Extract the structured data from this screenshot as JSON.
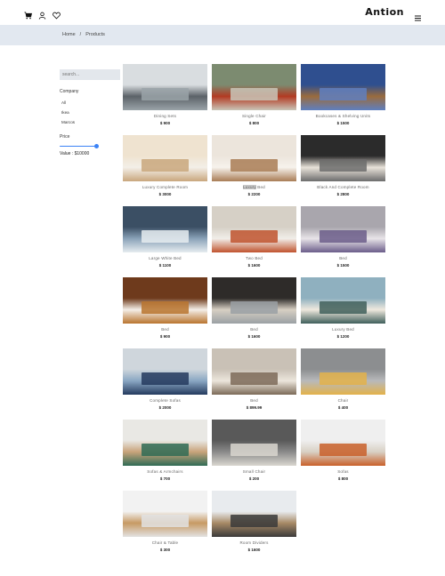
{
  "header": {
    "brand": "Antion",
    "icons": [
      "cart-icon",
      "user-icon",
      "heart-icon",
      "menu-icon"
    ]
  },
  "breadcrumb": {
    "home": "Home",
    "separator": "/",
    "current": "Products"
  },
  "sidebar": {
    "search_placeholder": "search...",
    "company_label": "Company",
    "companies": [
      "All",
      "Ikea",
      "Marcos"
    ],
    "price_label": "Price",
    "price_value_label": "Value : $10000",
    "price_fraction": 1.0
  },
  "products": [
    {
      "name": "Dining Sets",
      "price": "$ 900",
      "palette": [
        "#d9dde0",
        "#9aa3a8",
        "#5b6268"
      ]
    },
    {
      "name": "Single Chair",
      "price": "$ 800",
      "palette": [
        "#7c8b70",
        "#c9c5b8",
        "#b23a22"
      ]
    },
    {
      "name": "Bookcases & Shelving Units",
      "price": "$ 1500",
      "palette": [
        "#2f4f8f",
        "#5f7fbf",
        "#9a6b3d"
      ]
    },
    {
      "name": "Luxury Complete Room",
      "price": "$ 3000",
      "palette": [
        "#efe3d0",
        "#c9a77d",
        "#f3efe8"
      ]
    },
    {
      "name": "Two Bed",
      "price": "$ 2200",
      "palette": [
        "#ece5dc",
        "#a97c55",
        "#f6f2ec"
      ],
      "highlight": "Luxury"
    },
    {
      "name": "Black And Complete Room",
      "price": "$ 2800",
      "palette": [
        "#2b2b2b",
        "#6c6c6c",
        "#e9e3da"
      ]
    },
    {
      "name": "Large White Bed",
      "price": "$ 1100",
      "palette": [
        "#3b4f64",
        "#e6ecf0",
        "#8aa2b8"
      ]
    },
    {
      "name": "Two Bed",
      "price": "$ 1600",
      "palette": [
        "#d6d0c6",
        "#c0532e",
        "#f1eee9"
      ]
    },
    {
      "name": "Bed",
      "price": "$ 1500",
      "palette": [
        "#a9a6ad",
        "#6b5d8a",
        "#e8e4e8"
      ]
    },
    {
      "name": "Bed",
      "price": "$ 900",
      "palette": [
        "#6e3a1c",
        "#b9742e",
        "#f4efe8"
      ]
    },
    {
      "name": "Bed",
      "price": "$ 1600",
      "palette": [
        "#2e2b29",
        "#9aa0a4",
        "#d7cfc3"
      ]
    },
    {
      "name": "Luxury Bed",
      "price": "$ 1200",
      "palette": [
        "#8fb0bf",
        "#3f5f5b",
        "#efe9de"
      ]
    },
    {
      "name": "Complete Sofas",
      "price": "$ 2000",
      "palette": [
        "#cfd6dc",
        "#243a5e",
        "#8aa7c3"
      ]
    },
    {
      "name": "Bed",
      "price": "$ 899.99",
      "palette": [
        "#c9c1b6",
        "#7c6a58",
        "#ece6dc"
      ]
    },
    {
      "name": "Chair",
      "price": "$ 400",
      "palette": [
        "#8c8e90",
        "#e3b24a",
        "#b8b9bb"
      ]
    },
    {
      "name": "Sofas & Armchairs",
      "price": "$ 700",
      "palette": [
        "#e9e8e4",
        "#2f6b55",
        "#c8a37a"
      ]
    },
    {
      "name": "Small Chair",
      "price": "$ 200",
      "palette": [
        "#595959",
        "#d9d6cf",
        "#8a8a8a"
      ]
    },
    {
      "name": "Sofas",
      "price": "$ 800",
      "palette": [
        "#efefef",
        "#c9602a",
        "#d8d0c4"
      ]
    },
    {
      "name": "Chair & Table",
      "price": "$ 300",
      "palette": [
        "#f2f2f2",
        "#e2e2e2",
        "#c79a64"
      ]
    },
    {
      "name": "Room Dividers",
      "price": "$ 1600",
      "palette": [
        "#e8ebee",
        "#3a3a3a",
        "#a88a66"
      ]
    }
  ]
}
